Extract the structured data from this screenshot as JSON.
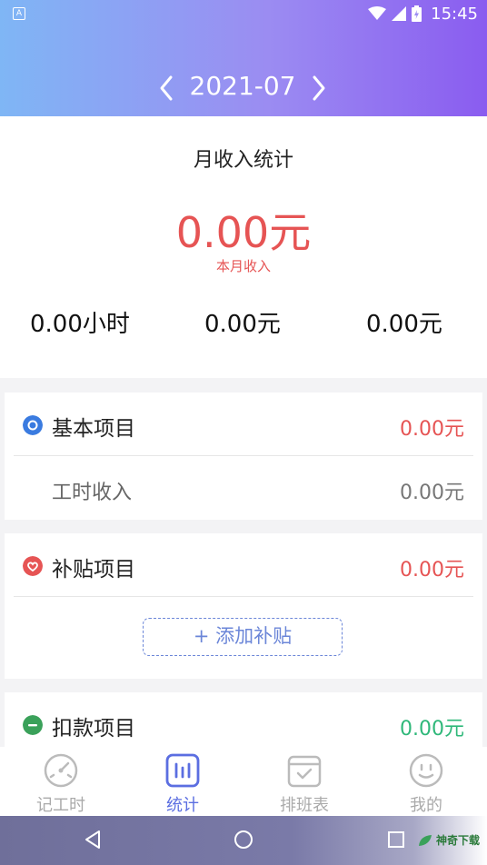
{
  "status_bar": {
    "left_icon_letter": "A",
    "time": "15:45"
  },
  "header": {
    "month": "2021-07"
  },
  "summary": {
    "title": "月收入统计",
    "amount": "0.00元",
    "caption": "本月收入",
    "stats": [
      "0.00小时",
      "0.00元",
      "0.00元"
    ]
  },
  "basic": {
    "title": "基本项目",
    "amount": "0.00元",
    "rows": [
      {
        "label": "工时收入",
        "value": "0.00元"
      }
    ]
  },
  "subsidy": {
    "title": "补贴项目",
    "amount": "0.00元",
    "add_button": "+ 添加补贴"
  },
  "deduction": {
    "title": "扣款项目",
    "amount": "0.00元"
  },
  "tabs": [
    {
      "label": "记工时",
      "icon": "gauge-icon",
      "active": false
    },
    {
      "label": "统计",
      "icon": "bar-chart-icon",
      "active": true
    },
    {
      "label": "排班表",
      "icon": "calendar-check-icon",
      "active": false
    },
    {
      "label": "我的",
      "icon": "smiley-icon",
      "active": false
    }
  ],
  "watermark": "神奇下载",
  "colors": {
    "accent": "#5b6ee1",
    "income_red": "#e65454",
    "deduction_green": "#2fb87a",
    "basic_blue": "#3a7be0"
  }
}
